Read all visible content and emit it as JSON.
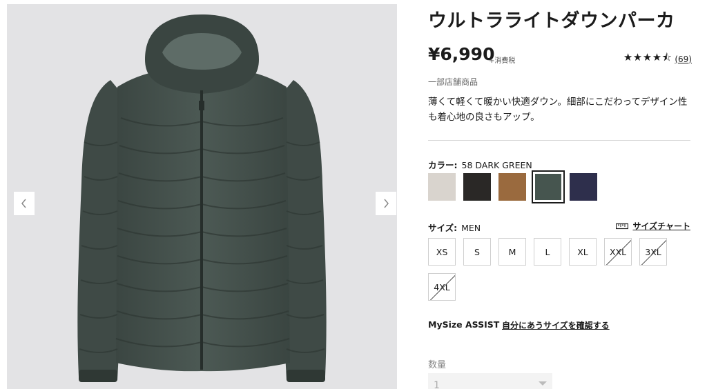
{
  "product": {
    "title": "ウルトラライトダウンパーカ",
    "price": "¥6,990",
    "tax_note": "+消費税",
    "rating_stars": "★★★★⯪",
    "rating_count": "(69)",
    "availability_note": "一部店舗商品",
    "description": "薄くて軽くて暖かい快適ダウン。細部にこだわってデザイン性も着心地の良さもアップ。"
  },
  "color": {
    "label": "カラー:",
    "selected": "58 DARK GREEN",
    "swatches": [
      {
        "name": "off-white",
        "hex": "#d9d4ce"
      },
      {
        "name": "black",
        "hex": "#2a2826"
      },
      {
        "name": "brown",
        "hex": "#9a6a3e"
      },
      {
        "name": "dark-green",
        "hex": "#46554f"
      },
      {
        "name": "navy",
        "hex": "#2e2f4c"
      }
    ]
  },
  "size": {
    "label": "サイズ:",
    "selected": "MEN",
    "chart_link": "サイズチャート",
    "options": [
      {
        "label": "XS",
        "available": true
      },
      {
        "label": "S",
        "available": true
      },
      {
        "label": "M",
        "available": true
      },
      {
        "label": "L",
        "available": true
      },
      {
        "label": "XL",
        "available": true
      },
      {
        "label": "XXL",
        "available": false
      },
      {
        "label": "3XL",
        "available": false
      },
      {
        "label": "4XL",
        "available": false
      }
    ]
  },
  "mysize": {
    "label": "MySize ASSIST",
    "link": "自分にあうサイズを確認する"
  },
  "quantity": {
    "label": "数量",
    "value": "1"
  },
  "gallery": {
    "jacket_color": "#44504b",
    "prev_icon": "chevron-left-icon",
    "next_icon": "chevron-right-icon"
  }
}
